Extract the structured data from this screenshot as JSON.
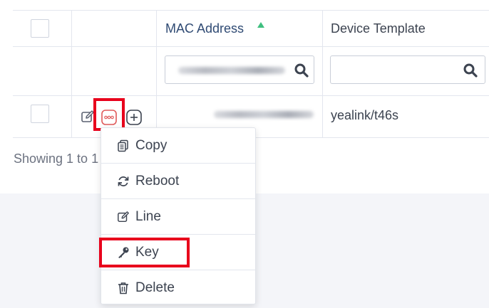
{
  "table": {
    "columns": {
      "mac_address": "MAC Address",
      "device_template": "Device Template"
    },
    "rows": [
      {
        "device_template": "yealink/t46s"
      }
    ]
  },
  "footer": {
    "showing_text": "Showing 1 to 1"
  },
  "action_menu": {
    "items": [
      {
        "label": "Copy",
        "icon": "copy-icon"
      },
      {
        "label": "Reboot",
        "icon": "refresh-icon"
      },
      {
        "label": "Line",
        "icon": "edit-icon"
      },
      {
        "label": "Key",
        "icon": "key-icon"
      },
      {
        "label": "Delete",
        "icon": "trash-icon"
      }
    ]
  },
  "colors": {
    "highlight": "#e8001c",
    "sort_indicator": "#3fbf7f",
    "header_active": "#2f4a73",
    "more_button": "#e05a5a"
  }
}
